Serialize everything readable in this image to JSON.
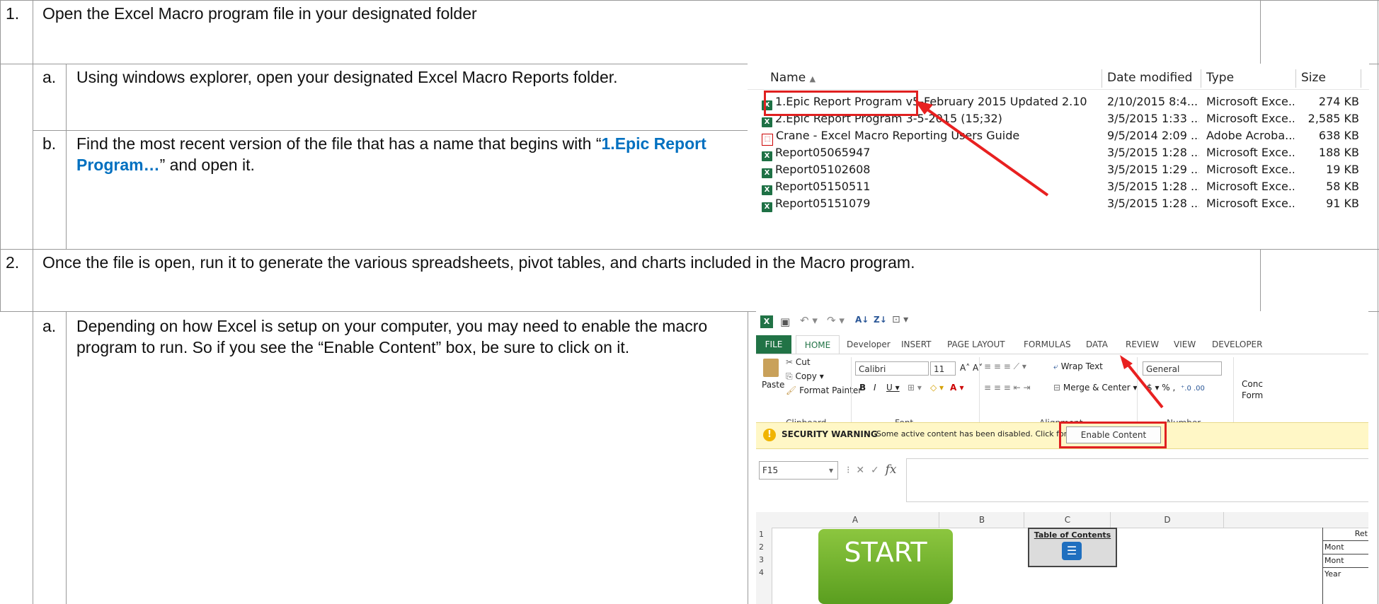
{
  "steps": [
    {
      "number": "1.",
      "text": "Open the Excel Macro program file in your designated folder"
    },
    {
      "number": "2.",
      "text": "Once the file is open, run it to generate the various spreadsheets, pivot tables, and charts included in the Macro program."
    }
  ],
  "substeps": {
    "a1": {
      "letter": "a.",
      "text": "Using windows explorer, open your designated Excel Macro Reports folder."
    },
    "b1": {
      "letter": "b.",
      "text_before": "Find the most recent version of the file that has a name that begins with “",
      "highlight": "1.Epic Report Program…",
      "text_after": "” and open it."
    },
    "a2": {
      "letter": "a.",
      "text": "Depending on how Excel is setup on your computer, you may need to enable the macro program to run.  So if you see the “Enable Content” box, be sure to click on it."
    }
  },
  "explorer": {
    "columns": [
      "Name",
      "Date modified",
      "Type",
      "Size"
    ],
    "files": [
      {
        "name": "1.Epic Report Program v5-February 2015 Updated 2.10",
        "date": "2/10/2015 8:4...",
        "type": "Microsoft Exce...",
        "size": "274 KB",
        "icon": "excel-icon"
      },
      {
        "name": "2.Epic Report Program 3-5-2015 (15;32)",
        "date": "3/5/2015 1:33 ...",
        "type": "Microsoft Exce...",
        "size": "2,585 KB",
        "icon": "excel-icon"
      },
      {
        "name": "Crane - Excel Macro Reporting Users Guide",
        "date": "9/5/2014 2:09 ...",
        "type": "Adobe Acroba...",
        "size": "638 KB",
        "icon": "pdf-icon"
      },
      {
        "name": "Report05065947",
        "date": "3/5/2015 1:28 ...",
        "type": "Microsoft Exce...",
        "size": "188 KB",
        "icon": "excel-icon"
      },
      {
        "name": "Report05102608",
        "date": "3/5/2015 1:29 ...",
        "type": "Microsoft Exce...",
        "size": "19 KB",
        "icon": "excel-icon"
      },
      {
        "name": "Report05150511",
        "date": "3/5/2015 1:28 ...",
        "type": "Microsoft Exce...",
        "size": "58 KB",
        "icon": "excel-icon"
      },
      {
        "name": "Report05151079",
        "date": "3/5/2015 1:28 ...",
        "type": "Microsoft Exce...",
        "size": "91 KB",
        "icon": "excel-icon"
      }
    ]
  },
  "excel": {
    "tabs": [
      "FILE",
      "HOME",
      "Developer",
      "INSERT",
      "PAGE LAYOUT",
      "FORMULAS",
      "DATA",
      "REVIEW",
      "VIEW",
      "DEVELOPER"
    ],
    "clipboard": {
      "paste": "Paste",
      "cut": "Cut",
      "copy": "Copy",
      "format_painter": "Format Painter",
      "group": "Clipboard"
    },
    "font": {
      "name": "Calibri",
      "size": "11",
      "group": "Font"
    },
    "alignment": {
      "wrap": "Wrap Text",
      "merge": "Merge & Center",
      "group": "Alignment"
    },
    "number": {
      "format": "General",
      "group": "Number",
      "currency": "$",
      "percent": "%",
      "comma": ","
    },
    "styles_partial": {
      "line1": "Conc",
      "line2": "Form"
    },
    "security": {
      "label": "SECURITY WARNING",
      "message": "Some active content has been disabled. Click for more details.",
      "button": "Enable Content"
    },
    "name_box": "F15",
    "fx": "fx",
    "columns": [
      "A",
      "B",
      "C",
      "D"
    ],
    "rows": [
      "1",
      "2",
      "3",
      "4"
    ],
    "start_button": "START",
    "toc_title": "Table of Contents",
    "right_cells": [
      "Ret",
      "Mont",
      "Mont",
      "Year"
    ],
    "accent_color": "#217346",
    "warning_color": "#fff7c6"
  }
}
